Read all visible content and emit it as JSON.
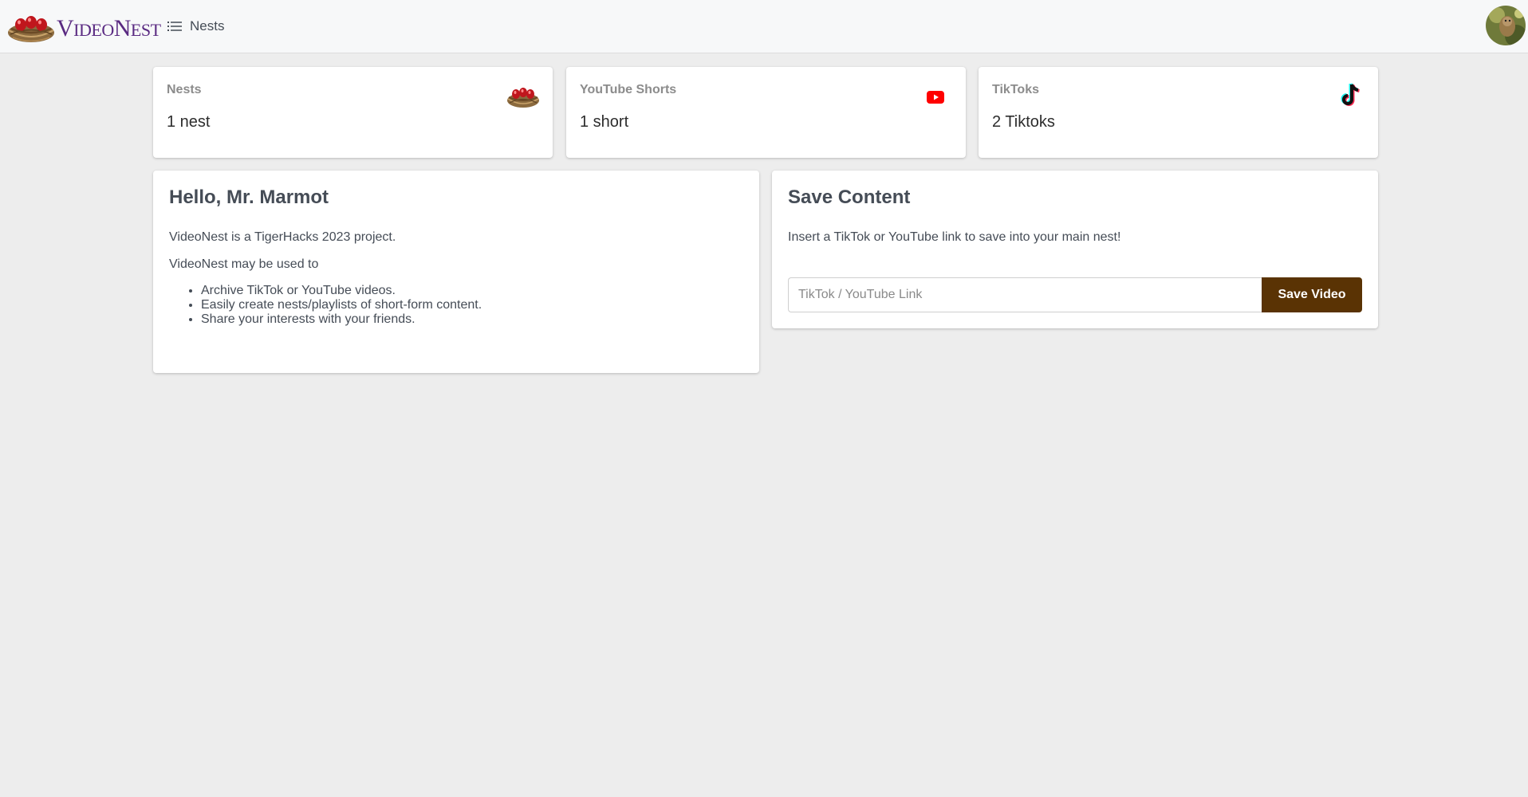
{
  "header": {
    "brand_text_first": "V",
    "brand_text_rest_1": "IDEO",
    "brand_text_mid": "N",
    "brand_text_rest_2": "EST",
    "logo_icon": "nest-icon",
    "nav_label": "Nests",
    "nav_icon": "list-icon",
    "avatar_icon": "user-avatar"
  },
  "stats": [
    {
      "label": "Nests",
      "value": "1 nest",
      "icon": "nest-icon"
    },
    {
      "label": "YouTube Shorts",
      "value": "1 short",
      "icon": "youtube-icon"
    },
    {
      "label": "TikToks",
      "value": "2 Tiktoks",
      "icon": "tiktok-icon"
    }
  ],
  "hello": {
    "title": "Hello, Mr. Marmot",
    "intro": "VideoNest is a TigerHacks 2023 project.",
    "uses_intro": "VideoNest may be used to",
    "uses": [
      "Archive TikTok or YouTube videos.",
      "Easily create nests/playlists of short-form content.",
      "Share your interests with your friends."
    ]
  },
  "save": {
    "title": "Save Content",
    "description": "Insert a TikTok or YouTube link to save into your main nest!",
    "input_placeholder": "TikTok / YouTube Link",
    "input_value": "",
    "button_label": "Save Video"
  },
  "colors": {
    "brand_purple": "#5a2a82",
    "button_brown": "#5a3304",
    "page_background": "#ededed",
    "youtube_red": "#ff0000"
  }
}
